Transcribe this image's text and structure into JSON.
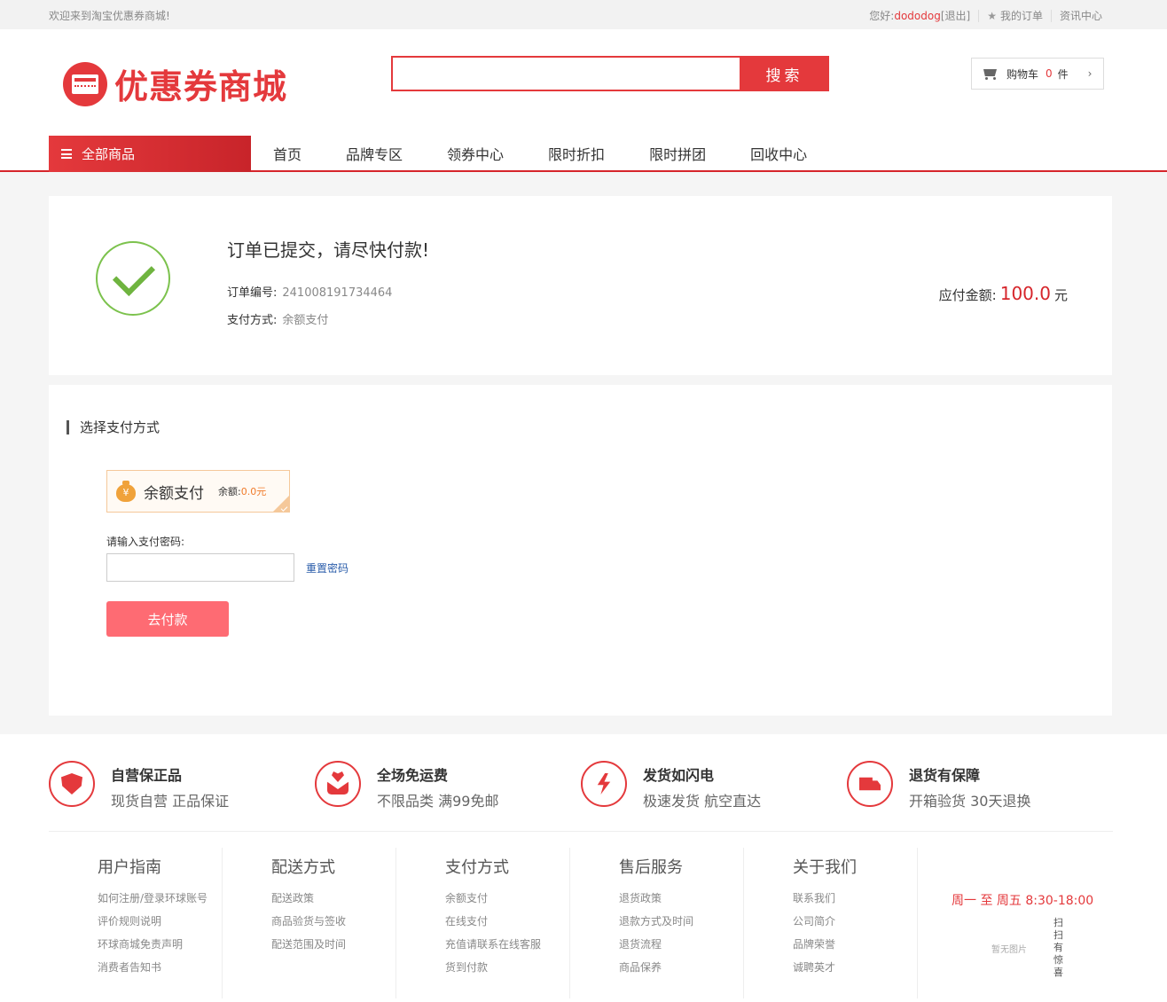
{
  "topbar": {
    "welcome": "欢迎来到淘宝优惠券商城!",
    "greeting": "您好:",
    "username": "dododog",
    "logout": "[退出]",
    "my_orders": "我的订单",
    "news": "资讯中心"
  },
  "header": {
    "logo_text": "优惠券商城",
    "search": {
      "placeholder": "",
      "button": "搜索"
    },
    "cart": {
      "label": "购物车",
      "count": "0",
      "unit": "件",
      "chevron": "›"
    }
  },
  "nav": {
    "all_label": "全部商品",
    "links": [
      "首页",
      "品牌专区",
      "领券中心",
      "限时折扣",
      "限时拼团",
      "回收中心"
    ]
  },
  "order": {
    "title": "订单已提交，请尽快付款!",
    "number_label": "订单编号:",
    "number": "241008191734464",
    "method_label": "支付方式:",
    "method": "余额支付",
    "amount_label": "应付金额:",
    "amount": "100.0",
    "amount_unit": "元"
  },
  "pay": {
    "section_title": "选择支付方式",
    "method_name": "余额支付",
    "balance_label": "余额:",
    "balance": "0.0元",
    "bag_symbol": "¥",
    "pwd_label": "请输入支付密码:",
    "reset": "重置密码",
    "submit": "去付款"
  },
  "footer": {
    "promises": [
      {
        "title": "自营保正品",
        "desc": "现货自营 正品保证",
        "icon": "shield-icon"
      },
      {
        "title": "全场免运费",
        "desc": "不限品类 满99免邮",
        "icon": "heart-hand-icon"
      },
      {
        "title": "发货如闪电",
        "desc": "极速发货 航空直达",
        "icon": "lightning-icon"
      },
      {
        "title": "退货有保障",
        "desc": "开箱验货 30天退换",
        "icon": "truck-icon"
      }
    ],
    "columns": [
      {
        "title": "用户指南",
        "links": [
          "如何注册/登录环球账号",
          "评价规则说明",
          "环球商城免责声明",
          "消费者告知书"
        ]
      },
      {
        "title": "配送方式",
        "links": [
          "配送政策",
          "商品验货与签收",
          "配送范围及时间"
        ]
      },
      {
        "title": "支付方式",
        "links": [
          "余额支付",
          "在线支付",
          "充值请联系在线客服",
          "货到付款"
        ]
      },
      {
        "title": "售后服务",
        "links": [
          "退货政策",
          "退款方式及时间",
          "退货流程",
          "商品保养"
        ]
      },
      {
        "title": "关于我们",
        "links": [
          "联系我们",
          "公司简介",
          "品牌荣誉",
          "诚聘英才"
        ]
      }
    ],
    "hours": "周一 至 周五   8:30-18:00",
    "no_image": "暂无图片",
    "scan_text": "扫扫有惊喜"
  },
  "colors": {
    "brand": "#e4393c",
    "success": "#7cc24d",
    "pay_button": "#fe6b73",
    "link": "#2a5caa"
  }
}
